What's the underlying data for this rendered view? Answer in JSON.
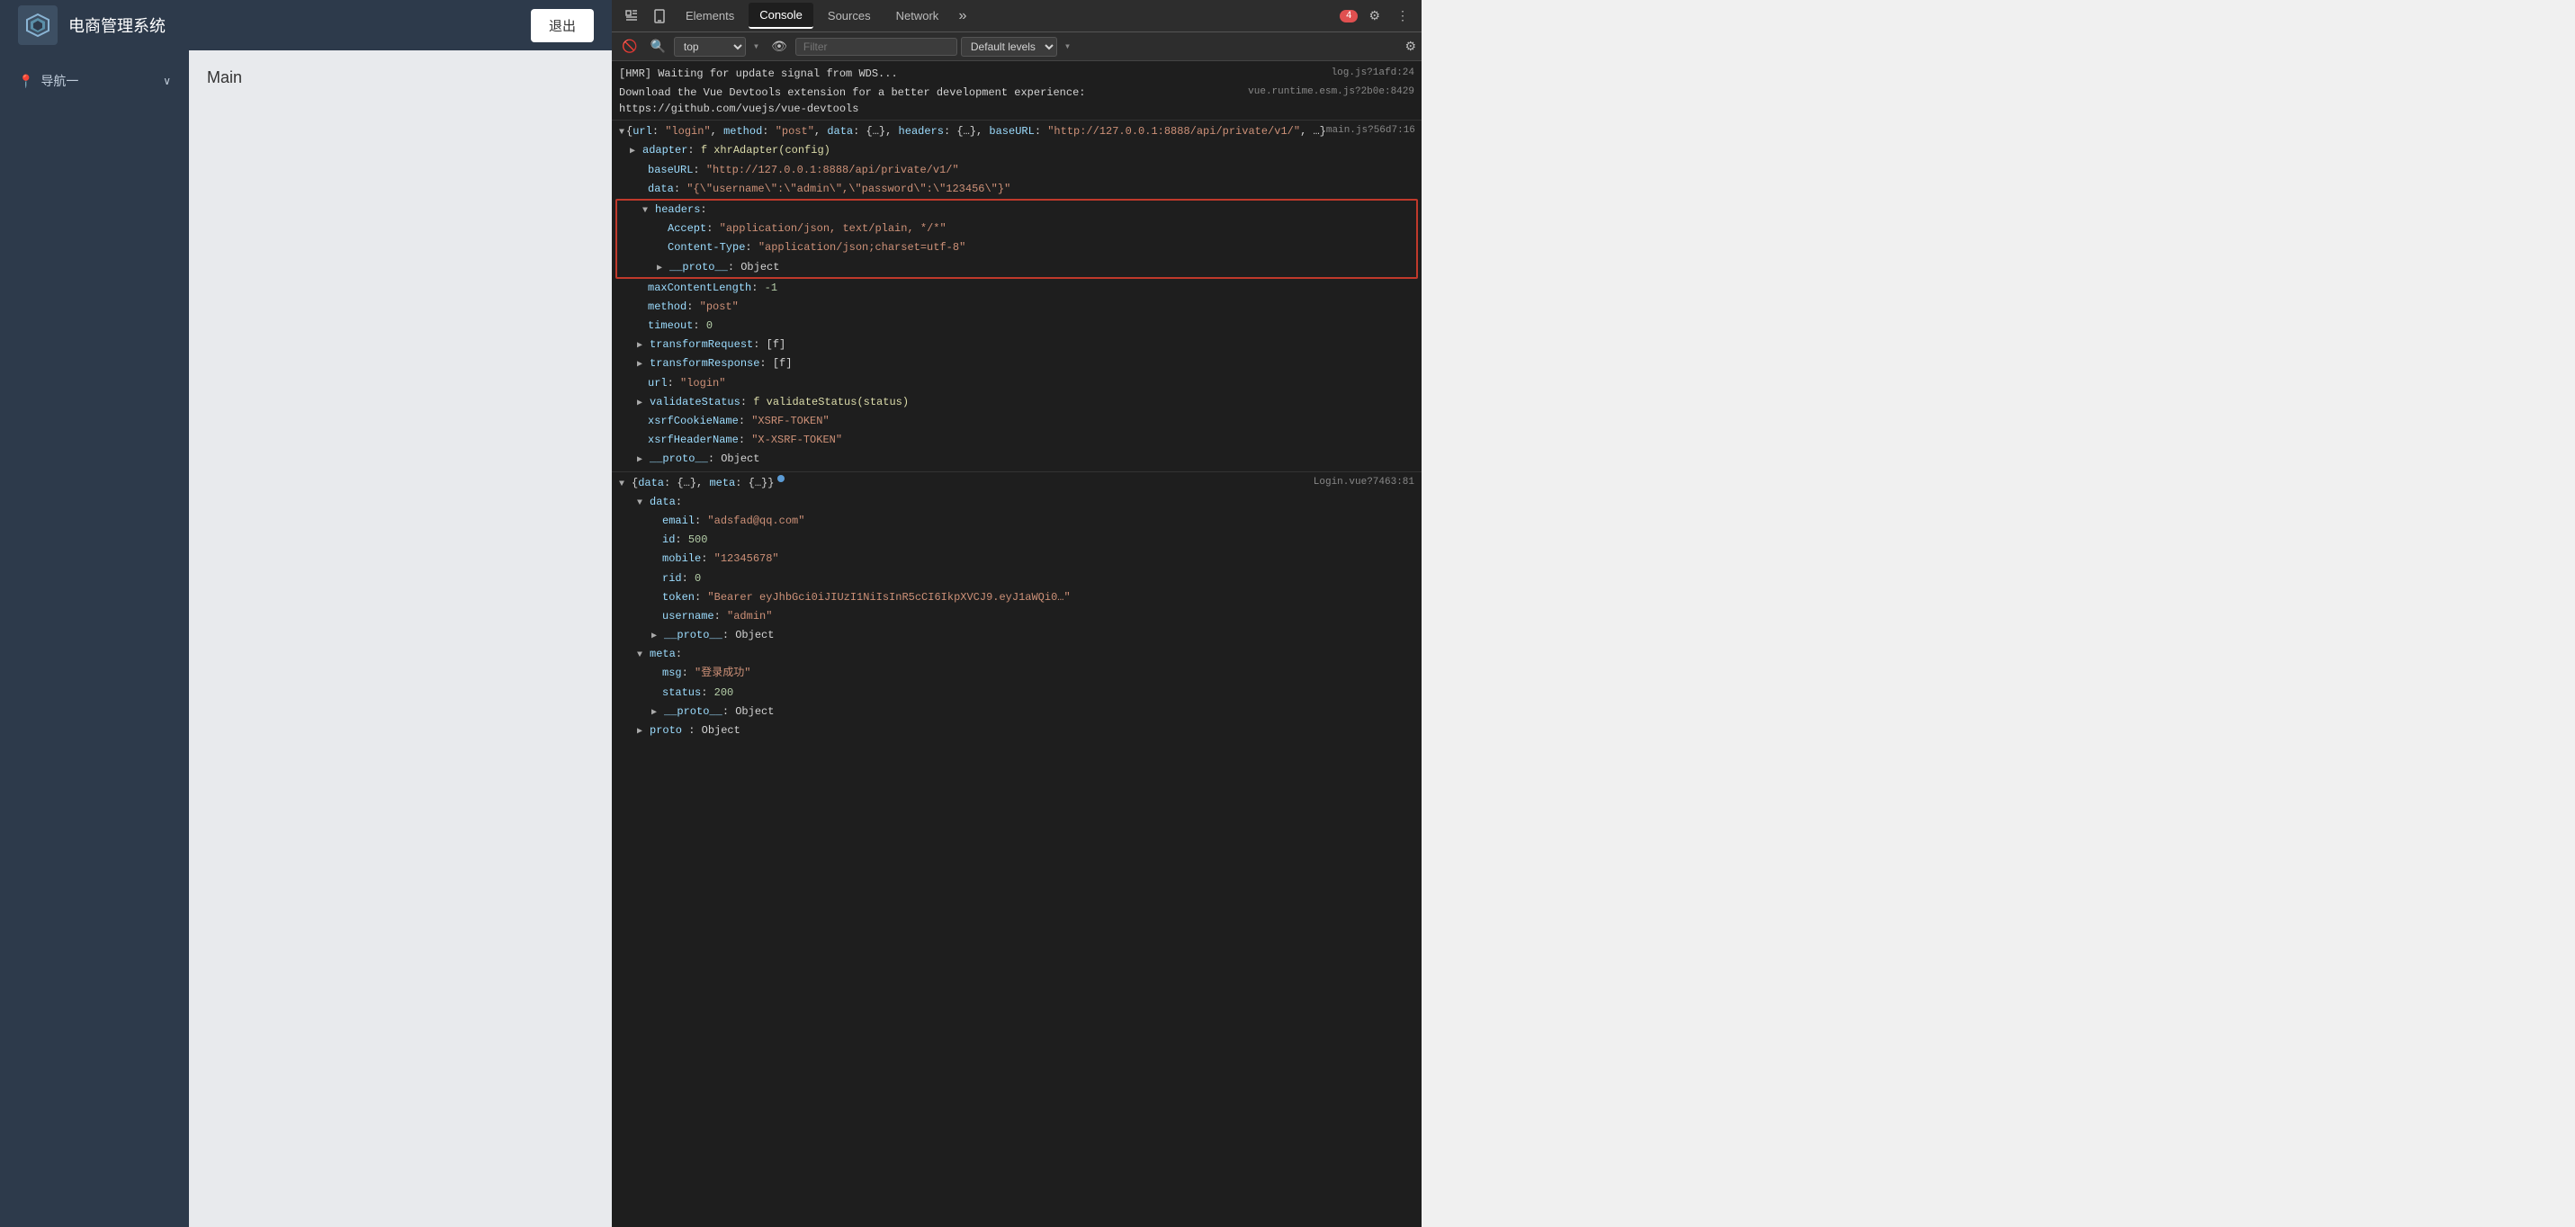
{
  "app": {
    "title": "电商管理系统",
    "logout_label": "退出",
    "main_label": "Main",
    "nav_item": "导航一"
  },
  "devtools": {
    "tabs": [
      "Elements",
      "Console",
      "Sources",
      "Network"
    ],
    "active_tab": "Console",
    "more_label": "»",
    "error_count": "4",
    "context_value": "top",
    "filter_placeholder": "Filter",
    "levels_label": "Default levels",
    "console_lines": [
      {
        "text": "[HMR] Waiting for update signal from WDS...",
        "source": "log.js?1afd:24",
        "indent": 0
      },
      {
        "text": "Download the Vue Devtools extension for a better development experience:",
        "source": "vue.runtime.esm.js?2b0e:8429",
        "indent": 0
      },
      {
        "text": "https://github.com/vuejs/vue-devtools",
        "source": "",
        "indent": 0,
        "is_link": true
      }
    ],
    "tree_main": {
      "source": "main.js?56d7:16",
      "root_preview": "{url: \"login\", method: \"post\", data: {...}, headers: {...}, baseURL: \"http://127.0.0.1:8888/api/private/v1/\", …}",
      "fields": [
        {
          "key": "adapter",
          "value": "f xhrAdapter(config)",
          "type": "func",
          "indent": 1
        },
        {
          "key": "baseURL",
          "value": "\"http://127.0.0.1:8888/api/private/v1/\"",
          "type": "string",
          "indent": 1
        },
        {
          "key": "data",
          "value": "\"{\\\"username\\\":\\\"admin\\\",\\\"password\\\":\\\"123456\\\"}\"",
          "type": "string",
          "indent": 1
        },
        {
          "key": "headers",
          "value": "",
          "type": "section_start",
          "indent": 1,
          "highlighted": true
        },
        {
          "key": "Accept",
          "value": "\"application/json, text/plain, */*\"",
          "type": "string",
          "indent": 2,
          "highlighted": true
        },
        {
          "key": "Content-Type",
          "value": "\"application/json;charset=utf-8\"",
          "type": "string",
          "indent": 2,
          "highlighted": true
        },
        {
          "key": "__proto__",
          "value": "Object",
          "type": "obj",
          "indent": 2,
          "highlighted": true,
          "section_end": true
        },
        {
          "key": "maxContentLength",
          "value": "-1",
          "type": "number",
          "indent": 1
        },
        {
          "key": "method",
          "value": "\"post\"",
          "type": "string",
          "indent": 1
        },
        {
          "key": "timeout",
          "value": "0",
          "type": "number",
          "indent": 1
        },
        {
          "key": "transformRequest",
          "value": "[f]",
          "type": "array",
          "indent": 1
        },
        {
          "key": "transformResponse",
          "value": "[f]",
          "type": "array",
          "indent": 1
        },
        {
          "key": "url",
          "value": "\"login\"",
          "type": "string",
          "indent": 1
        },
        {
          "key": "validateStatus",
          "value": "f validateStatus(status)",
          "type": "func",
          "indent": 1
        },
        {
          "key": "xsrfCookieName",
          "value": "\"XSRF-TOKEN\"",
          "type": "string",
          "indent": 1
        },
        {
          "key": "xsrfHeaderName",
          "value": "\"X-XSRF-TOKEN\"",
          "type": "string",
          "indent": 1
        },
        {
          "key": "__proto__",
          "value": "Object",
          "type": "obj",
          "indent": 1
        }
      ]
    },
    "tree_login": {
      "source": "Login.vue?7463:81",
      "root_preview": "{data: {...}, meta: {...}}",
      "has_dot": true,
      "fields": [
        {
          "key": "data",
          "value": "",
          "type": "expand",
          "indent": 1
        },
        {
          "key": "email",
          "value": "\"adsfad@qq.com\"",
          "type": "string",
          "indent": 2
        },
        {
          "key": "id",
          "value": "500",
          "type": "number",
          "indent": 2
        },
        {
          "key": "mobile",
          "value": "\"12345678\"",
          "type": "string",
          "indent": 2
        },
        {
          "key": "rid",
          "value": "0",
          "type": "number",
          "indent": 2
        },
        {
          "key": "token",
          "value": "\"Bearer eyJhbGci0iJIUzI1NiIsInR5cCI6IkpXVCJ9.eyJ1aWQi0…\"",
          "type": "string",
          "indent": 2
        },
        {
          "key": "username",
          "value": "\"admin\"",
          "type": "string",
          "indent": 2
        },
        {
          "key": "__proto__",
          "value": "Object",
          "type": "obj",
          "indent": 2
        },
        {
          "key": "meta",
          "value": "",
          "type": "expand",
          "indent": 1
        },
        {
          "key": "msg",
          "value": "\"登录成功\"",
          "type": "string",
          "indent": 2
        },
        {
          "key": "status",
          "value": "200",
          "type": "number",
          "indent": 2
        },
        {
          "key": "__proto__",
          "value": "Object",
          "type": "obj",
          "indent": 2
        },
        {
          "key": "proto",
          "value": "Object",
          "type": "obj",
          "indent": 1
        }
      ]
    }
  }
}
